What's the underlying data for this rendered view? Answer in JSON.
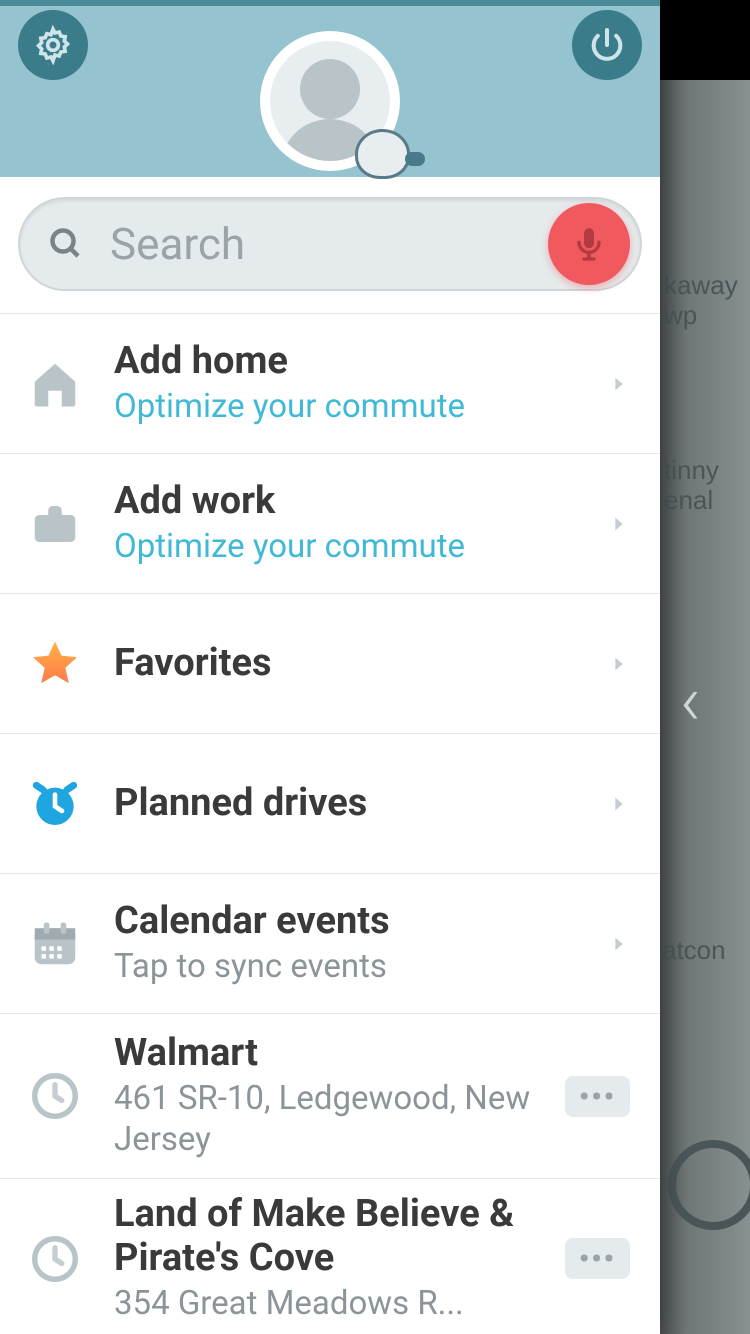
{
  "search": {
    "placeholder": "Search"
  },
  "menu": {
    "home": {
      "title": "Add home",
      "sub": "Optimize your commute"
    },
    "work": {
      "title": "Add work",
      "sub": "Optimize your commute"
    },
    "favorites": {
      "title": "Favorites"
    },
    "planned": {
      "title": "Planned drives"
    },
    "calendar": {
      "title": "Calendar events",
      "sub": "Tap to sync events"
    }
  },
  "recent": [
    {
      "title": "Walmart",
      "address": "461 SR-10, Ledgewood, New Jersey"
    },
    {
      "title": "Land of Make Believe & Pirate's Cove",
      "address": "354 Great Meadows R..."
    }
  ],
  "map_labels": {
    "a": "kaway",
    "b": "wp",
    "c": "tinny",
    "d": "enal",
    "e": "atcon"
  }
}
